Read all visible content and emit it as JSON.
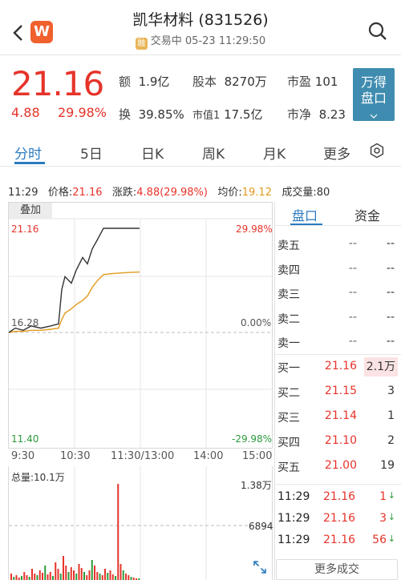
{
  "header": {
    "logo_letter": "W",
    "title": "凯华材料 (831526)",
    "badge": "融",
    "subtitle": "交易中 05-23 11:29:50"
  },
  "quote": {
    "price": "21.16",
    "change": "4.88",
    "change_pct": "29.98%",
    "amount_label": "额",
    "amount": "1.9亿",
    "shares_label": "股本",
    "shares": "8270万",
    "pe_label": "市盈",
    "pe": "101",
    "turnover_label": "换",
    "turnover": "39.85%",
    "mktcap_label": "市值1",
    "mktcap": "17.5亿",
    "pb_label": "市净",
    "pb": "8.23",
    "wande_btn_line1": "万得",
    "wande_btn_line2": "盘口"
  },
  "tabs": [
    "分时",
    "5日",
    "日K",
    "周K",
    "月K",
    "更多"
  ],
  "info": {
    "time": "11:29",
    "price_label": "价格:",
    "price": "21.16",
    "chg_label": "涨跌:",
    "chg": "4.88(29.98%)",
    "avg_label": "均价:",
    "avg": "19.12",
    "vol_label": "成交量:",
    "vol": "80"
  },
  "chart": {
    "overlay_btn": "叠加",
    "y_top_left": "21.16",
    "y_mid_left": "16.28",
    "y_bot_left": "11.40",
    "y_top_right": "29.98%",
    "y_mid_right": "0.00%",
    "y_bot_right": "-29.98%",
    "times": [
      "9:30",
      "10:30",
      "11:30/13:00",
      "14:00",
      "15:00"
    ],
    "vol_total": "总量:10.1万",
    "vol_top": "1.38万",
    "vol_mid": "6894"
  },
  "chart_data": {
    "type": "line",
    "x_range": [
      "9:30",
      "15:00"
    ],
    "ylim": [
      11.4,
      21.16
    ],
    "prev_close": 16.28,
    "series": [
      {
        "values": [
          16.3,
          16.5,
          16.4,
          16.6,
          16.5,
          16.6,
          16.7,
          18.3,
          18.9,
          18.6,
          19.2,
          19.8,
          19.5,
          20.2,
          20.6,
          21.16,
          21.16,
          21.16,
          21.16
        ]
      },
      {
        "values": [
          16.3,
          16.35,
          16.35,
          16.4,
          16.4,
          16.45,
          16.5,
          16.9,
          17.2,
          17.4,
          17.6,
          17.8,
          18.0,
          18.4,
          18.7,
          19.0,
          19.05,
          19.1,
          19.12
        ]
      }
    ]
  },
  "orderbook": {
    "tab_active": "盘口",
    "tab_other": "资金",
    "asks": [
      {
        "label": "卖五",
        "price": "--",
        "vol": "--"
      },
      {
        "label": "卖四",
        "price": "--",
        "vol": "--"
      },
      {
        "label": "卖三",
        "price": "--",
        "vol": "--"
      },
      {
        "label": "卖二",
        "price": "--",
        "vol": "--"
      },
      {
        "label": "卖一",
        "price": "--",
        "vol": "--"
      }
    ],
    "bids": [
      {
        "label": "买一",
        "price": "21.16",
        "vol": "2.1万"
      },
      {
        "label": "买二",
        "price": "21.15",
        "vol": "3"
      },
      {
        "label": "买三",
        "price": "21.14",
        "vol": "1"
      },
      {
        "label": "买四",
        "price": "21.10",
        "vol": "2"
      },
      {
        "label": "买五",
        "price": "21.00",
        "vol": "19"
      }
    ],
    "trades": [
      {
        "time": "11:29",
        "price": "21.16",
        "vol": "1"
      },
      {
        "time": "11:29",
        "price": "21.16",
        "vol": "3"
      },
      {
        "time": "11:29",
        "price": "21.16",
        "vol": "56"
      }
    ],
    "more_label": "更多成交"
  },
  "colors": {
    "up": "#e6332a",
    "down": "#2b9a3c",
    "accent": "#2a7bc0",
    "avg": "#e29a1c"
  }
}
